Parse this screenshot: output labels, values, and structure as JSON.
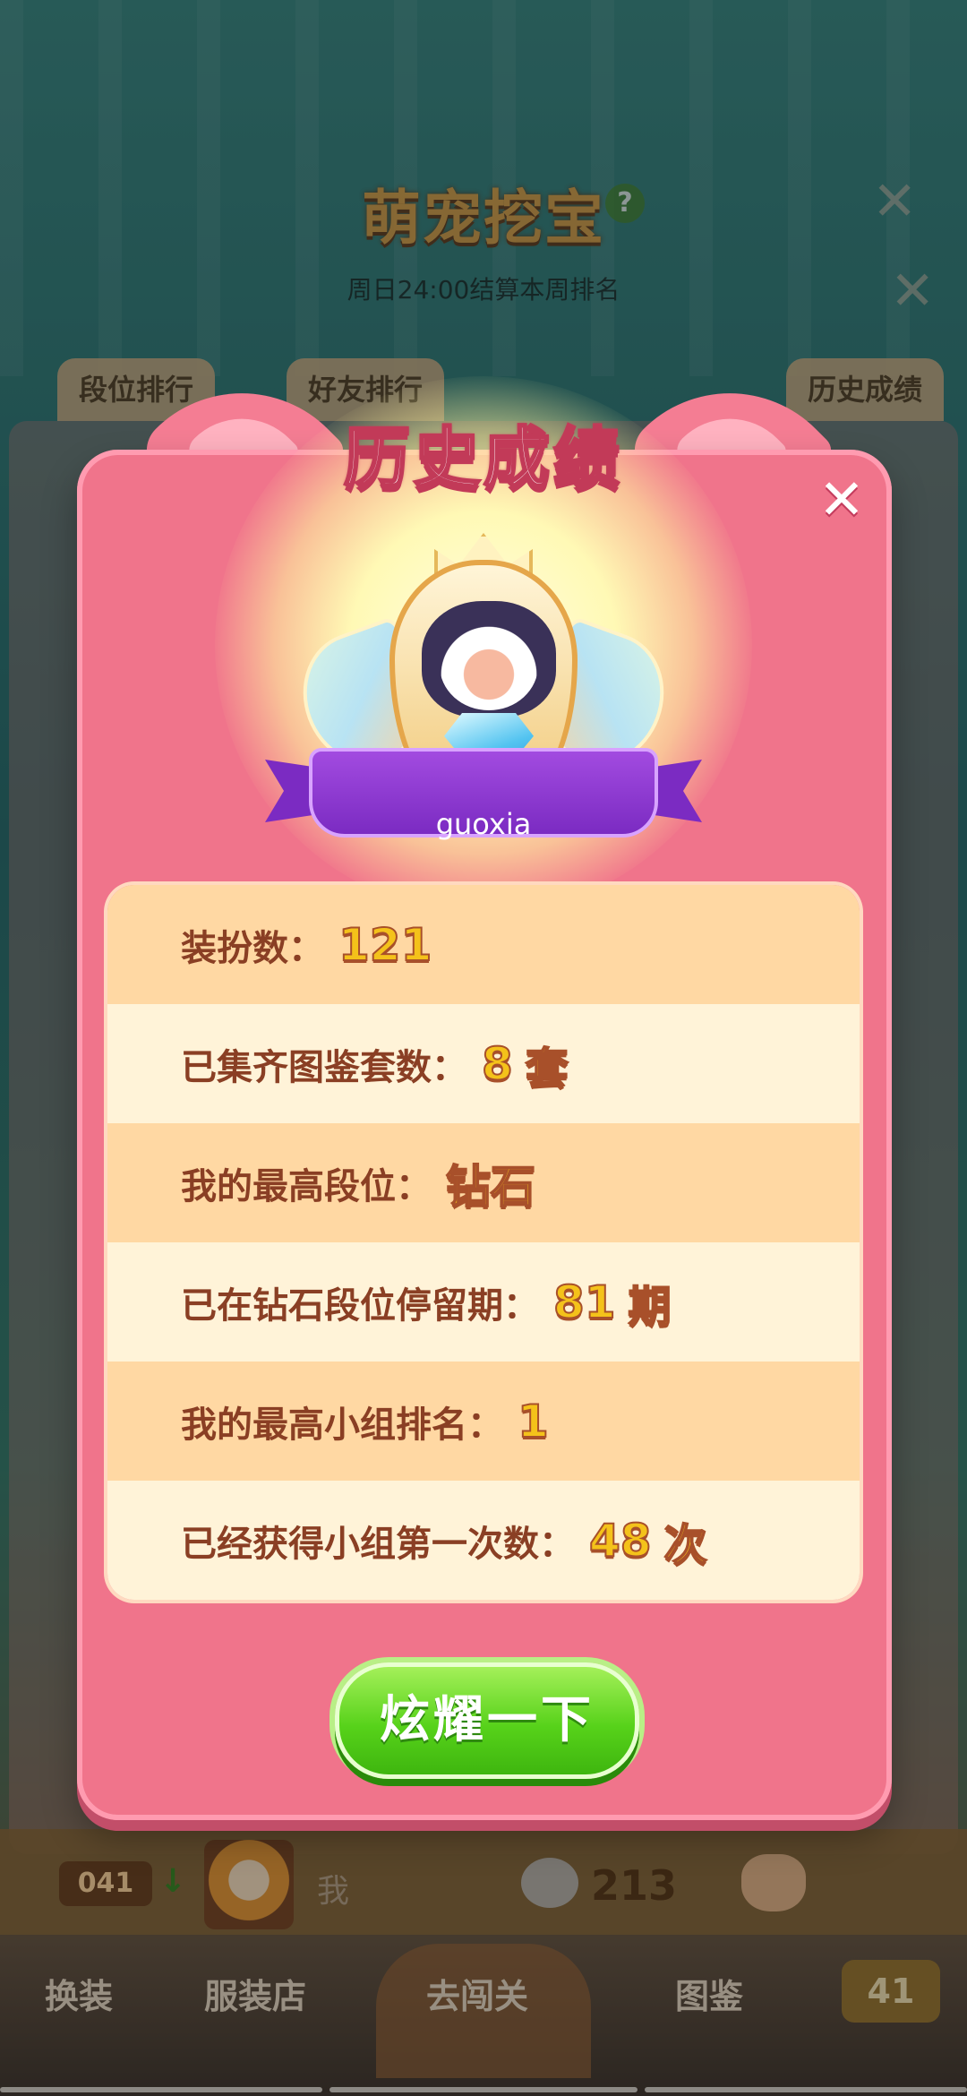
{
  "background": {
    "game_title": "萌宠挖宝",
    "help_glyph": "?",
    "subtitle": "周日24:00结算本周排名",
    "tabs": [
      "段位排行",
      "好友排行",
      "历史成绩"
    ],
    "player_bar": {
      "rank": "041",
      "name": "我",
      "score": "213"
    },
    "nav": [
      "换装",
      "服装店",
      "去闯关",
      "图鉴"
    ],
    "level": "41"
  },
  "modal": {
    "title": "历史成绩",
    "close_glyph": "✕",
    "player_name": "guoxia",
    "stats": [
      {
        "label": "装扮数：",
        "value": "121",
        "unit": ""
      },
      {
        "label": "已集齐图鉴套数：",
        "value": "8",
        "unit": "套"
      },
      {
        "label": "我的最高段位：",
        "value": "钻石",
        "unit": ""
      },
      {
        "label": "已在钻石段位停留期：",
        "value": "81",
        "unit": "期"
      },
      {
        "label": "我的最高小组排名：",
        "value": "1",
        "unit": ""
      },
      {
        "label": "已经获得小组第一次数：",
        "value": "48",
        "unit": "次"
      }
    ],
    "share_button": "炫耀一下"
  },
  "colors": {
    "modal_pink": "#f0748b",
    "row_orange": "#ffd8a3",
    "row_cream": "#fff3d8",
    "label_brown": "#8a3f24",
    "value_gold": "#f4c21a",
    "button_green": "#57d21a",
    "ribbon_purple": "#7b2bc2"
  },
  "icons": [
    "help-icon",
    "close-icon",
    "rank-down-arrow-icon",
    "avatar",
    "chat-bubble-icon",
    "cat-icon",
    "trophy-badge-icon"
  ]
}
